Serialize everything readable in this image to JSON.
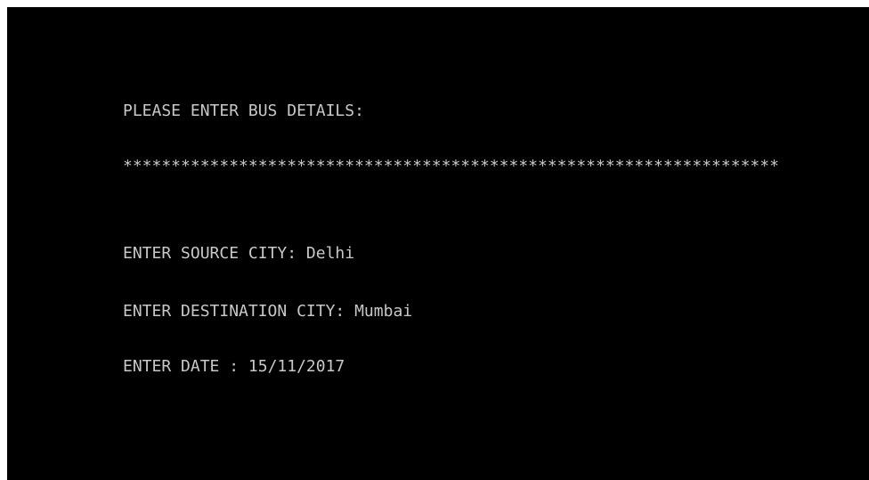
{
  "console": {
    "heading": "PLEASE ENTER BUS DETAILS:",
    "separator": "********************************************************************",
    "prompts": {
      "source": {
        "label": "ENTER SOURCE CITY: ",
        "value": "Delhi"
      },
      "destination": {
        "label": "ENTER DESTINATION CITY: ",
        "value": "Mumbai"
      },
      "date": {
        "label": "ENTER DATE : ",
        "value": "15/11/2017"
      }
    }
  },
  "colors": {
    "background": "#000000",
    "text": "#c8c8c8",
    "border": "#ffffff"
  }
}
